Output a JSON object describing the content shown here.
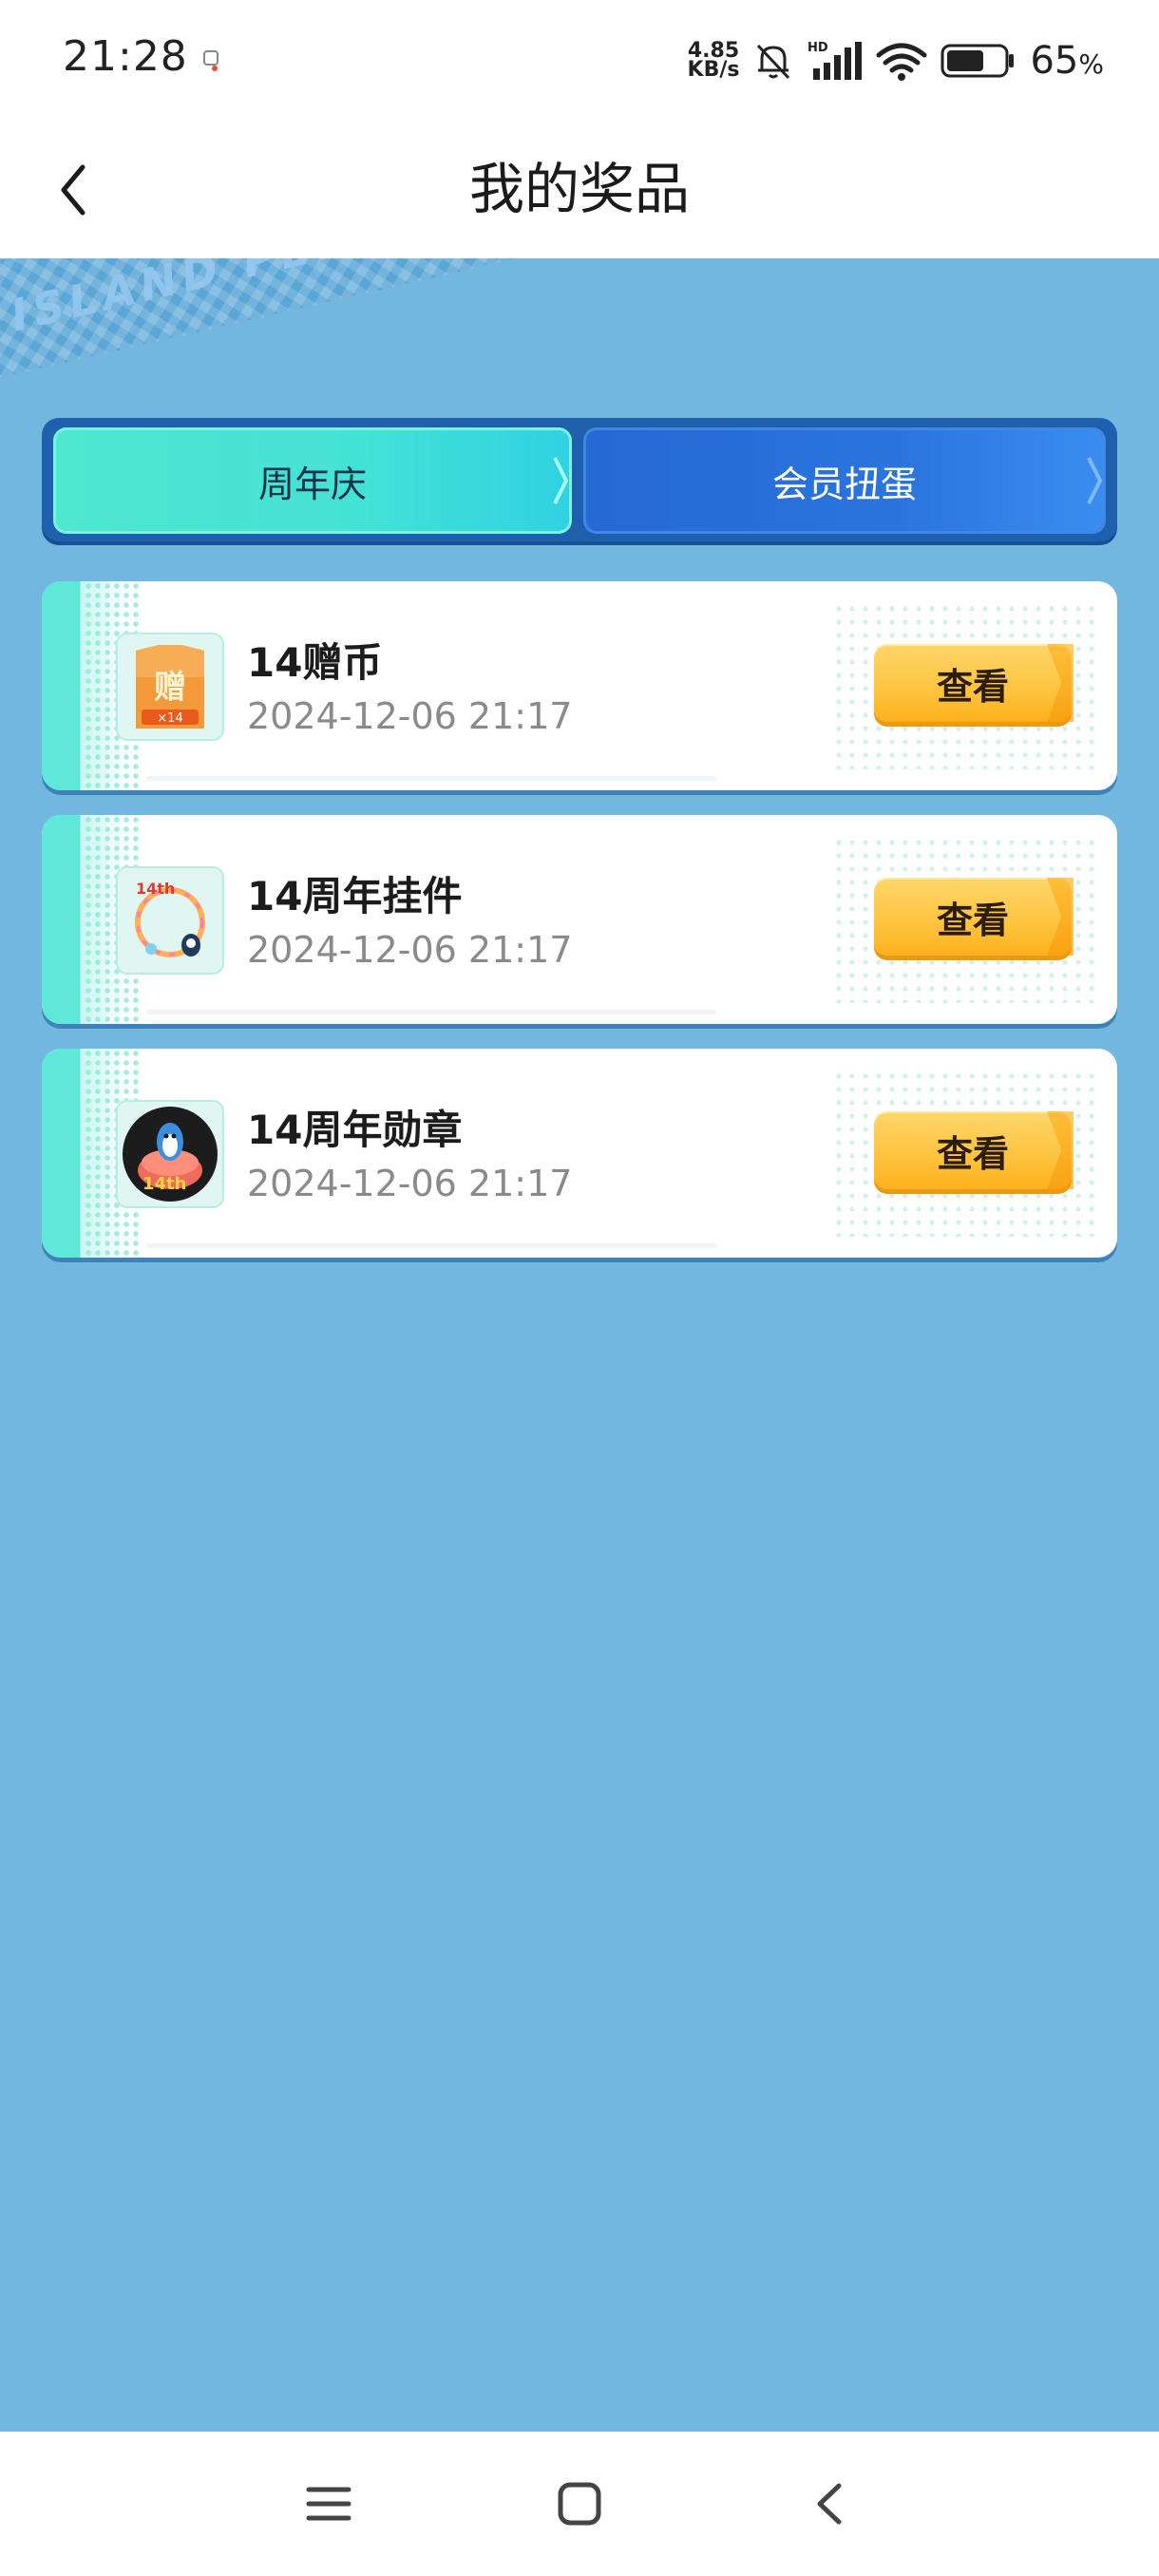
{
  "status_bar": {
    "time": "21:28",
    "net_speed_value": "4.85",
    "net_speed_unit": "KB/s",
    "battery_percent": "65",
    "battery_percent_sign": "%",
    "battery_level": 0.65,
    "signal_label": "HD"
  },
  "header": {
    "title": "我的奖品"
  },
  "banner": {
    "ribbon_text": "ISLAND  PENGUIN ISLAND"
  },
  "tabs": [
    {
      "label": "周年庆",
      "active": true
    },
    {
      "label": "会员扭蛋",
      "active": false
    }
  ],
  "prizes": [
    {
      "name": "14赠币",
      "time": "2024-12-06 21:17",
      "button": "查看",
      "icon": "gift-coin-icon",
      "icon_text": "赠",
      "icon_badge": "×14"
    },
    {
      "name": "14周年挂件",
      "time": "2024-12-06 21:17",
      "button": "查看",
      "icon": "avatar-frame-icon",
      "icon_text": "14th"
    },
    {
      "name": "14周年勋章",
      "time": "2024-12-06 21:17",
      "button": "查看",
      "icon": "medal-icon",
      "icon_text": "14th"
    }
  ],
  "colors": {
    "background": "#72b8de",
    "tab_active": "#4ee8cf",
    "tab_inactive": "#2768d3",
    "button": "#ffc33d"
  }
}
